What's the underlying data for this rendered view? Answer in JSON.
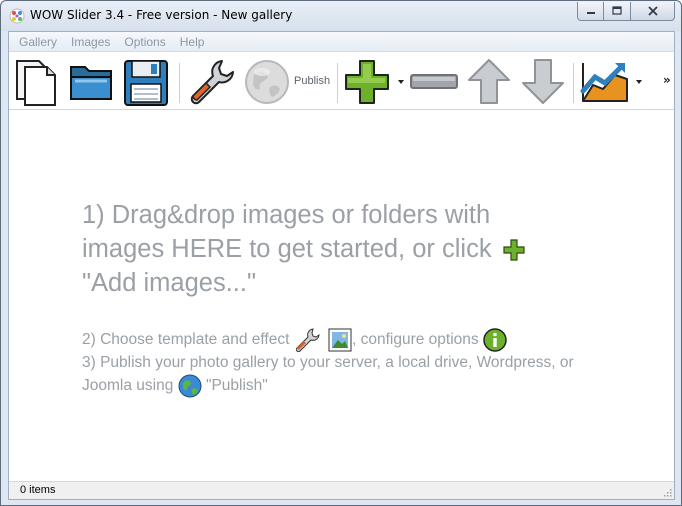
{
  "window": {
    "title": "WOW Slider 3.4 - Free version - New gallery"
  },
  "menu": {
    "items": [
      "Gallery",
      "Images",
      "Options",
      "Help"
    ]
  },
  "toolbar": {
    "publish_label": "Publish",
    "overflow_glyph": "»",
    "icons": [
      "new-document-icon",
      "open-folder-icon",
      "save-disk-icon",
      "wrench-icon",
      "globe-icon",
      "plus-icon",
      "minus-icon",
      "arrow-up-icon",
      "arrow-down-icon",
      "chart-icon"
    ]
  },
  "instructions": {
    "step1_lines": [
      "1) Drag&drop images or folders with",
      "images HERE to get started, or click",
      "\"Add images...\""
    ],
    "step2_prefix": "2) Choose template and effect",
    "step2_suffix": ", configure options",
    "step3_text": "3) Publish your photo gallery to your server, a local drive, Wordpress, or Joomla using",
    "step3_suffix": "\"Publish\""
  },
  "status": {
    "items_text": "0 items"
  },
  "colors": {
    "instruction_text": "#9aa0a6",
    "menu_text_disabled": "#8d97a5",
    "accent_green": "#5aa012"
  }
}
